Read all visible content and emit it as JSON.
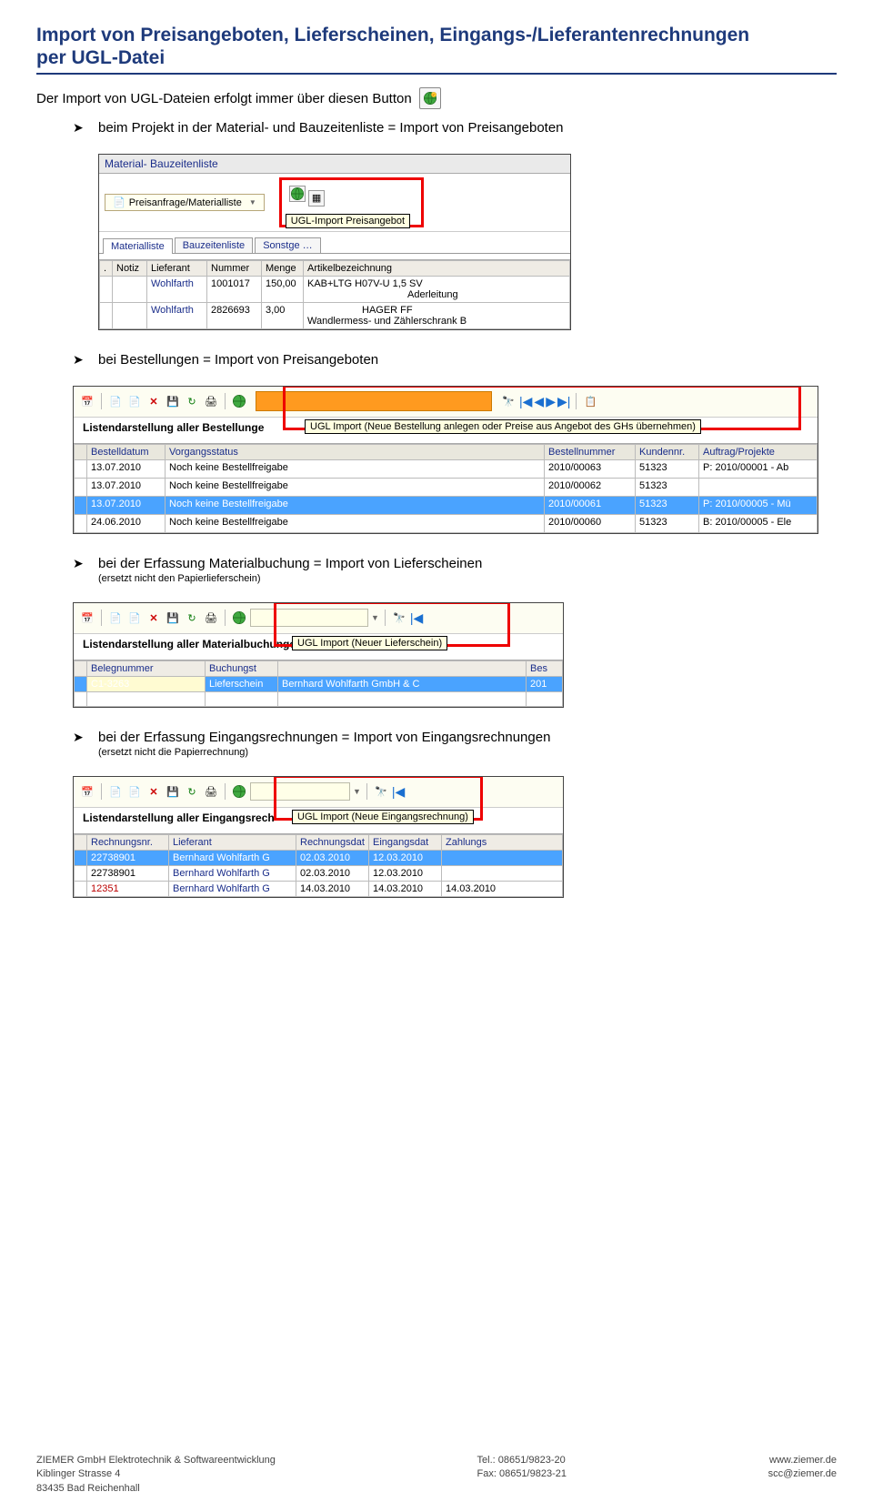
{
  "title_line1": "Import von Preisangeboten, Lieferscheinen, Eingangs-/Lieferantenrechnungen",
  "title_line2": "per UGL-Datei",
  "intro": "Der Import von UGL-Dateien erfolgt immer über diesen Button",
  "bullets": {
    "b1": "beim Projekt in der Material- und Bauzeitenliste = Import von Preisangeboten",
    "b2": "bei Bestellungen = Import von Preisangeboten",
    "b3": "bei der Erfassung Materialbuchung = Import von Lieferscheinen",
    "b3_note": "(ersetzt nicht den Papierlieferschein)",
    "b4": "bei der Erfassung Eingangsrechnungen = Import von Eingangsrechnungen",
    "b4_note": "(ersetzt nicht die Papierrechnung)"
  },
  "shot1": {
    "title": "Material- Bauzeitenliste",
    "btn": "Preisanfrage/Materialliste",
    "tooltip": "UGL-Import Preisangebot",
    "tabs": [
      "Materialliste",
      "Bauzeitenliste",
      "Sonst"
    ],
    "tab_rest": "ge …",
    "cols": [
      ".",
      "Notiz",
      "Lieferant",
      "Nummer",
      "Menge",
      "Artikelbezeichnung"
    ],
    "rows": [
      {
        "lieferant": "Wohlfarth",
        "nummer": "1001017",
        "menge": "150,00",
        "bez1": "KAB+LTG   H07V-U 1,5 SV",
        "bez2": "Aderleitung"
      },
      {
        "lieferant": "Wohlfarth",
        "nummer": "2826693",
        "menge": "3,00",
        "bez1": "HAGER      FF",
        "bez2": "Wandlermess- und Zählerschrank B"
      }
    ]
  },
  "shot2": {
    "list_title": "Listendarstellung aller Bestellunge",
    "tooltip": "UGL Import (Neue Bestellung anlegen oder Preise aus Angebot des GHs übernehmen)",
    "cols": [
      "Bestelldatum",
      "Vorgangsstatus",
      "Bestellnummer",
      "Kundennr.",
      "Auftrag/Projekte"
    ],
    "rows": [
      {
        "d": "13.07.2010",
        "s": "Noch keine Bestellfreigabe",
        "nr": "2010/00063",
        "k": "51323",
        "p": "P: 2010/00001 - Ab"
      },
      {
        "d": "13.07.2010",
        "s": "Noch keine Bestellfreigabe",
        "nr": "2010/00062",
        "k": "51323",
        "p": ""
      },
      {
        "d": "13.07.2010",
        "s": "Noch keine Bestellfreigabe",
        "nr": "2010/00061",
        "k": "51323",
        "p": "P: 2010/00005 - Mü",
        "hl": true
      },
      {
        "d": "24.06.2010",
        "s": "Noch keine Bestellfreigabe",
        "nr": "2010/00060",
        "k": "51323",
        "p": "B: 2010/00005 - Ele"
      }
    ]
  },
  "shot3": {
    "list_title": "Listendarstellung aller Materialb",
    "list_title_rest": "uchungen",
    "tooltip": "UGL Import (Neuer Lieferschein)",
    "cols": [
      "Belegnummer",
      "Buchungst",
      "",
      "Bes"
    ],
    "row": {
      "c1": "C1-3263",
      "c2": "Lieferschein",
      "c3": "Bernhard Wohlfarth GmbH & C",
      "c4": "201"
    }
  },
  "shot4": {
    "list_title": "Listendarstellung aller Eingangsr",
    "list_title_rest": "ech",
    "tooltip": "UGL Import (Neue Eingangsrechnung)",
    "cols": [
      "Rechnungsnr.",
      "Lieferant",
      "Rechnungsdat",
      "Eingangsdat",
      "Zahlungs"
    ],
    "rows": [
      {
        "r": "22738901",
        "l": "Bernhard Wohlfarth G",
        "rd": "02.03.2010",
        "ed": "12.03.2010",
        "z": "",
        "hl": true
      },
      {
        "r": "22738901",
        "l": "Bernhard Wohlfarth G",
        "rd": "02.03.2010",
        "ed": "12.03.2010",
        "z": ""
      },
      {
        "r": "12351",
        "l": "Bernhard Wohlfarth G",
        "rd": "14.03.2010",
        "ed": "14.03.2010",
        "z": "14.03.2010",
        "red": true
      }
    ]
  },
  "footer": {
    "left1": "ZIEMER GmbH Elektrotechnik & Softwareentwicklung",
    "left2": "Kiblinger Strasse 4",
    "left3": "83435 Bad Reichenhall",
    "mid1": "Tel.: 08651/9823-20",
    "mid2": "Fax: 08651/9823-21",
    "right1": "www.ziemer.de",
    "right2": "scc@ziemer.de"
  }
}
